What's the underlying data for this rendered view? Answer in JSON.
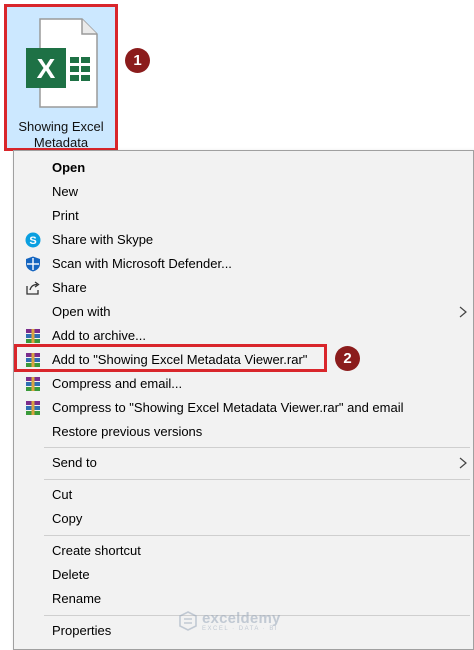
{
  "file": {
    "label": "Showing Excel Metadata",
    "app_letter": "X"
  },
  "badges": {
    "first": "1",
    "second": "2"
  },
  "menu": {
    "items": [
      {
        "key": "open",
        "label": "Open",
        "icon": ""
      },
      {
        "key": "new",
        "label": "New",
        "icon": ""
      },
      {
        "key": "print",
        "label": "Print",
        "icon": ""
      },
      {
        "key": "skype",
        "label": "Share with Skype",
        "icon": "skype-icon"
      },
      {
        "key": "defender",
        "label": "Scan with Microsoft Defender...",
        "icon": "defender-shield-icon"
      },
      {
        "key": "share",
        "label": "Share",
        "icon": "share-icon"
      },
      {
        "key": "openwith",
        "label": "Open with",
        "icon": ""
      },
      {
        "key": "archive",
        "label": "Add to archive...",
        "icon": "winrar-icon"
      },
      {
        "key": "addrar",
        "label": "Add to \"Showing Excel Metadata Viewer.rar\"",
        "icon": "winrar-icon"
      },
      {
        "key": "compressemail",
        "label": "Compress and email...",
        "icon": "winrar-icon"
      },
      {
        "key": "compressrar",
        "label": "Compress to \"Showing Excel Metadata Viewer.rar\" and email",
        "icon": "winrar-icon"
      },
      {
        "key": "restore",
        "label": "Restore previous versions",
        "icon": ""
      },
      {
        "key": "sendto",
        "label": "Send to",
        "icon": ""
      },
      {
        "key": "cut",
        "label": "Cut",
        "icon": ""
      },
      {
        "key": "copy",
        "label": "Copy",
        "icon": ""
      },
      {
        "key": "shortcut",
        "label": "Create shortcut",
        "icon": ""
      },
      {
        "key": "delete",
        "label": "Delete",
        "icon": ""
      },
      {
        "key": "rename",
        "label": "Rename",
        "icon": ""
      },
      {
        "key": "properties",
        "label": "Properties",
        "icon": ""
      }
    ]
  },
  "watermark": {
    "name": "exceldemy",
    "tagline": "EXCEL · DATA · BI"
  },
  "colors": {
    "highlight": "#d9262b",
    "badge": "#8b1c1c",
    "excel_green": "#1e7145",
    "selection": "#cce8ff"
  }
}
